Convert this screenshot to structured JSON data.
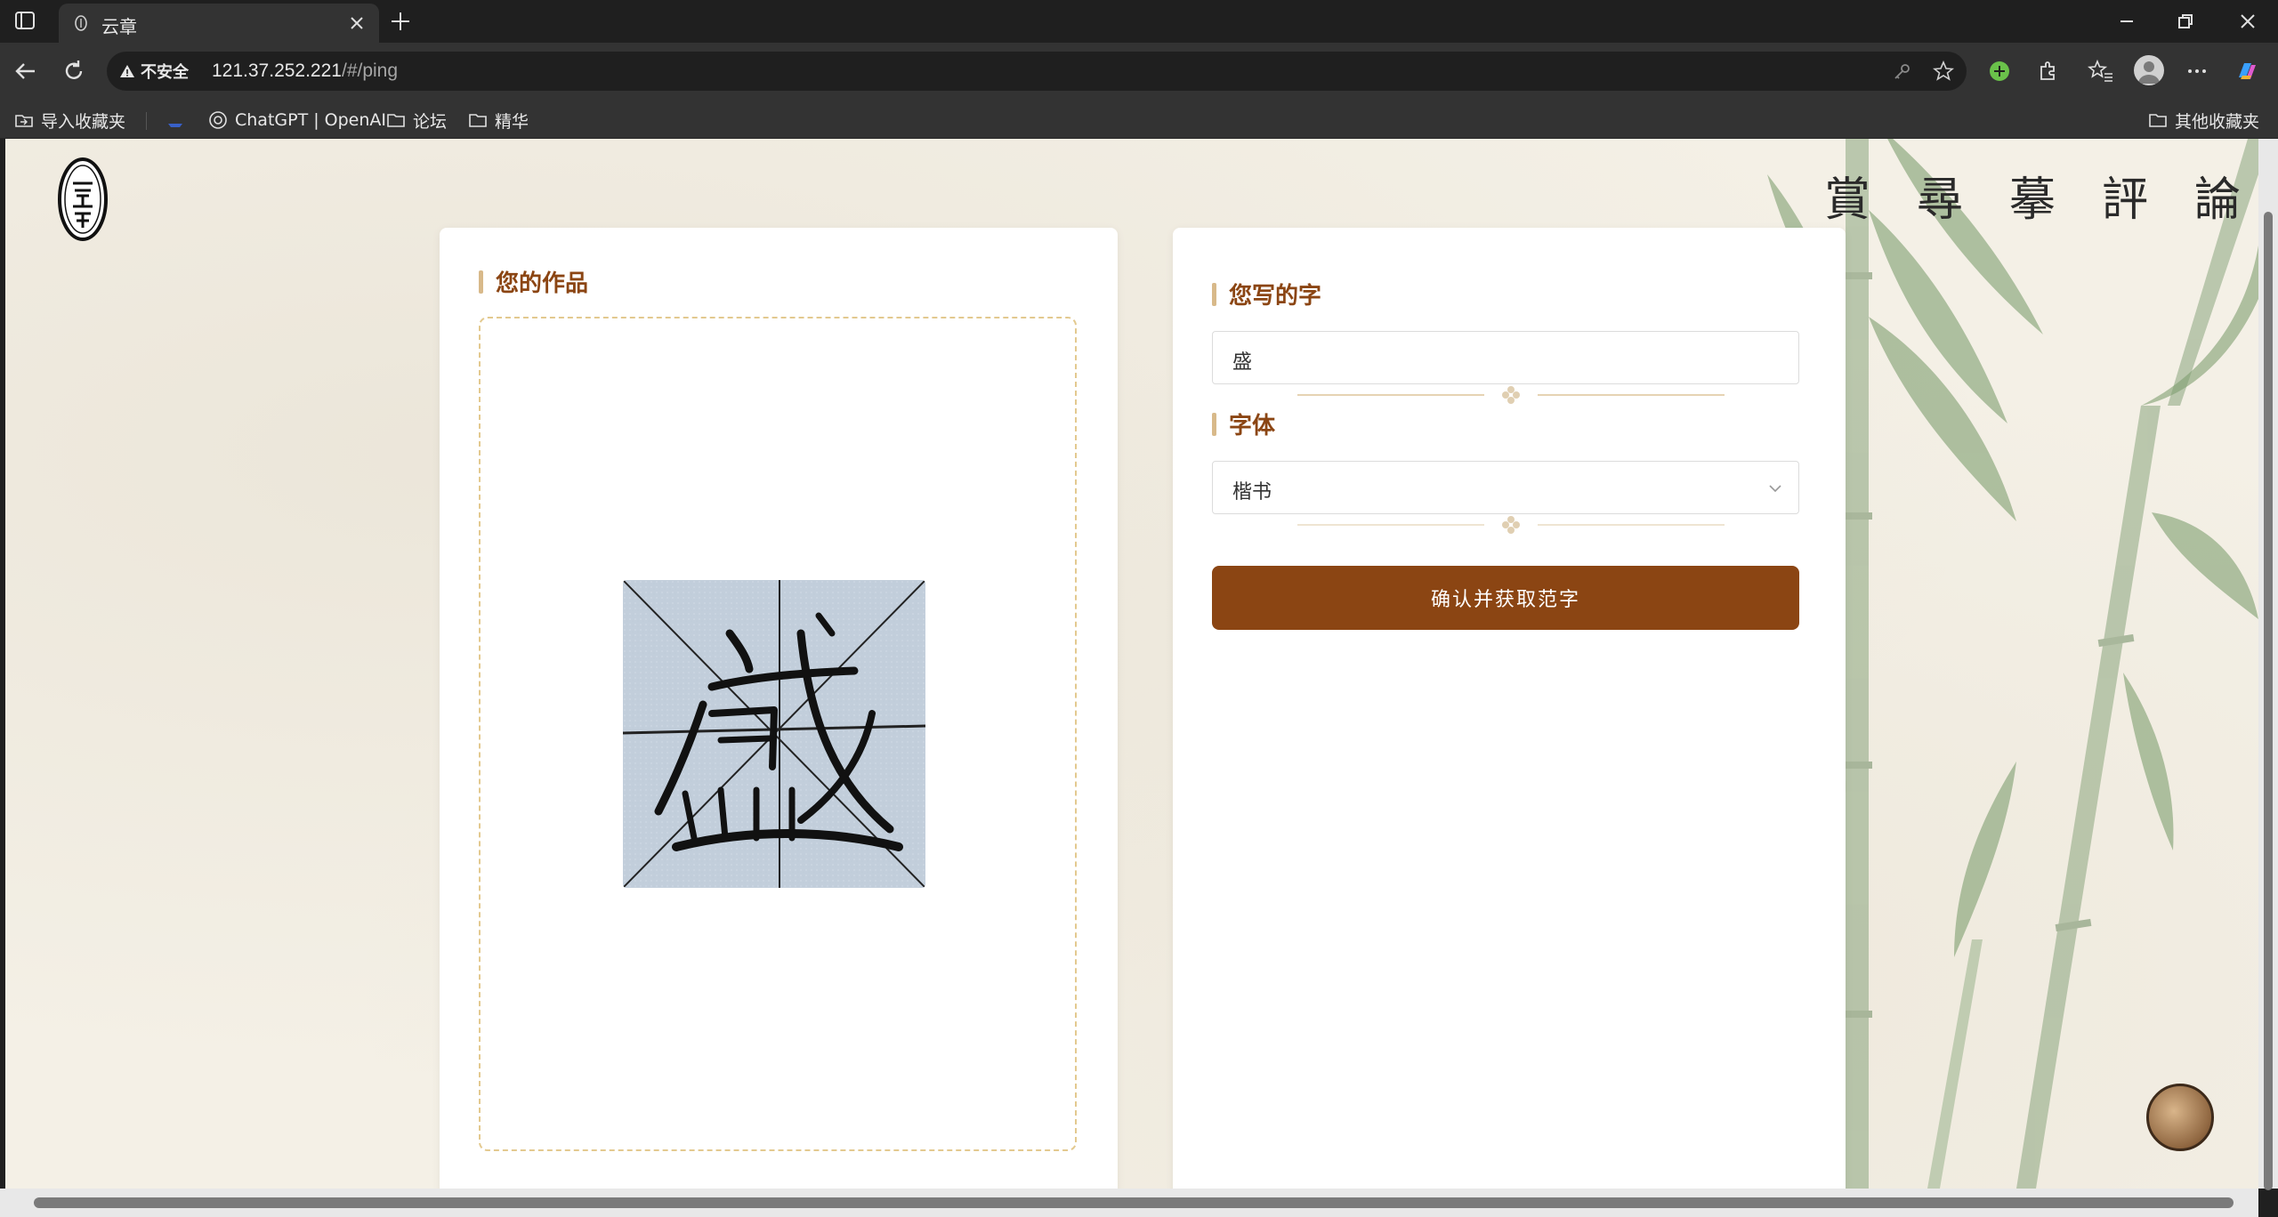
{
  "browser": {
    "tab_title": "云章",
    "security_label": "不安全",
    "url_host": "121.37.252.221",
    "url_path": "/#/ping",
    "bookmarks": {
      "import": "导入收藏夹",
      "chatgpt": "ChatGPT | OpenAI",
      "forum": "论坛",
      "essence": "精华",
      "other": "其他收藏夹"
    }
  },
  "header": {
    "logo_text": "云章",
    "nav": [
      "賞",
      "尋",
      "摹",
      "評",
      "論"
    ]
  },
  "left_panel": {
    "title": "您的作品",
    "image_alt": "盛"
  },
  "right_panel": {
    "char_label": "您写的字",
    "char_value": "盛",
    "font_label": "字体",
    "font_value": "楷书",
    "confirm_label": "确认并获取范字"
  },
  "colors": {
    "accent": "#8b4513",
    "section_bar": "#d8b98a",
    "dashed_border": "#e3c98f",
    "page_bg": "#f4f0e6"
  }
}
